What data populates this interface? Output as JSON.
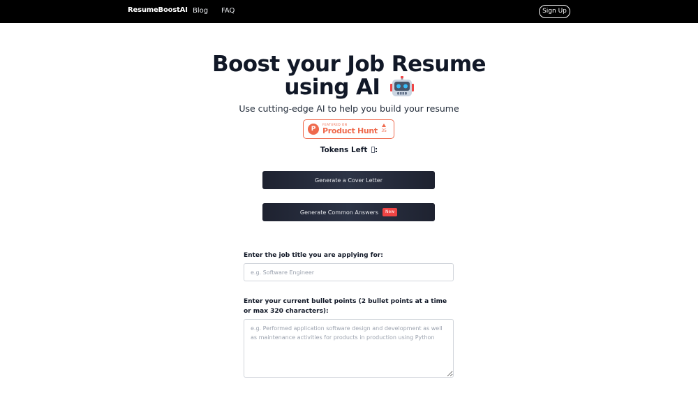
{
  "nav": {
    "brand": "ResumeBoostAI",
    "links": [
      "Blog",
      "FAQ"
    ],
    "signup_label": "Sign Up"
  },
  "hero": {
    "title_line1": "Boost your Job Resume",
    "title_line2": "using AI",
    "title_icon": "robot-icon",
    "subtitle": "Use cutting-edge AI to help you build your resume"
  },
  "product_hunt": {
    "featured_label": "FEATURED ON",
    "name": "Product Hunt",
    "votes": "35",
    "color": "#ef6a4d"
  },
  "tokens": {
    "label": "Tokens Left",
    "suffix": ":"
  },
  "actions": {
    "cover_letter_label": "Generate a Cover Letter",
    "common_answers_label": "Generate Common Answers",
    "new_badge": "New"
  },
  "form": {
    "job_title_label": "Enter the job title you are applying for:",
    "job_title_placeholder": "e.g. Software Engineer",
    "job_title_value": "",
    "bullets_label": "Enter your current bullet points (2 bullet points at a time or max 320 characters):",
    "bullets_placeholder": "e.g. Performed application software design and development as well as maintenance activities for products in production using Python",
    "bullets_value": ""
  },
  "colors": {
    "navbar_bg": "#000000",
    "button_bg": "#1e2230",
    "badge_red": "#ef4444"
  }
}
